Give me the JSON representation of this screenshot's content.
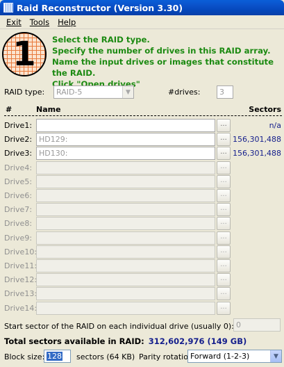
{
  "window": {
    "title": "Raid Reconstructor (Version 3.30)"
  },
  "menu": [
    "Exit",
    "Tools",
    "Help"
  ],
  "step": {
    "number": "1",
    "lines": [
      "Select the RAID type.",
      "Specify the number of drives in this RAID array.",
      "Name the input drives or images that constitute the RAID.",
      "Click \"Open drives\""
    ]
  },
  "raid_type": {
    "label": "RAID type:",
    "value": "RAID-5"
  },
  "drives_count": {
    "label": "#drives:",
    "value": "3"
  },
  "table": {
    "headers": {
      "num": "#",
      "name": "Name",
      "sectors": "Sectors"
    },
    "browse_label": "...",
    "rows": [
      {
        "label": "Drive1:",
        "value": "",
        "sectors": "n/a",
        "enabled": true
      },
      {
        "label": "Drive2:",
        "value": "HD129:",
        "sectors": "156,301,488",
        "enabled": true
      },
      {
        "label": "Drive3:",
        "value": "HD130:",
        "sectors": "156,301,488",
        "enabled": true
      },
      {
        "label": "Drive4:",
        "value": "",
        "sectors": "",
        "enabled": false
      },
      {
        "label": "Drive5:",
        "value": "",
        "sectors": "",
        "enabled": false
      },
      {
        "label": "Drive6:",
        "value": "",
        "sectors": "",
        "enabled": false
      },
      {
        "label": "Drive7:",
        "value": "",
        "sectors": "",
        "enabled": false
      },
      {
        "label": "Drive8:",
        "value": "",
        "sectors": "",
        "enabled": false
      },
      {
        "label": "Drive9:",
        "value": "",
        "sectors": "",
        "enabled": false
      },
      {
        "label": "Drive10:",
        "value": "",
        "sectors": "",
        "enabled": false
      },
      {
        "label": "Drive11:",
        "value": "",
        "sectors": "",
        "enabled": false
      },
      {
        "label": "Drive12:",
        "value": "",
        "sectors": "",
        "enabled": false
      },
      {
        "label": "Drive13:",
        "value": "",
        "sectors": "",
        "enabled": false
      },
      {
        "label": "Drive14:",
        "value": "",
        "sectors": "",
        "enabled": false
      }
    ]
  },
  "start_sector": {
    "label": "Start sector of the RAID on each individual drive (usually 0):",
    "value": "0"
  },
  "total": {
    "label": "Total sectors available in RAID:",
    "value": "312,602,976 (149 GB)"
  },
  "block_size": {
    "label": "Block size:",
    "value": "128",
    "unit": "sectors (64 KB)"
  },
  "parity": {
    "label": "Parity rotation:",
    "value": "Forward (1-2-3)"
  }
}
